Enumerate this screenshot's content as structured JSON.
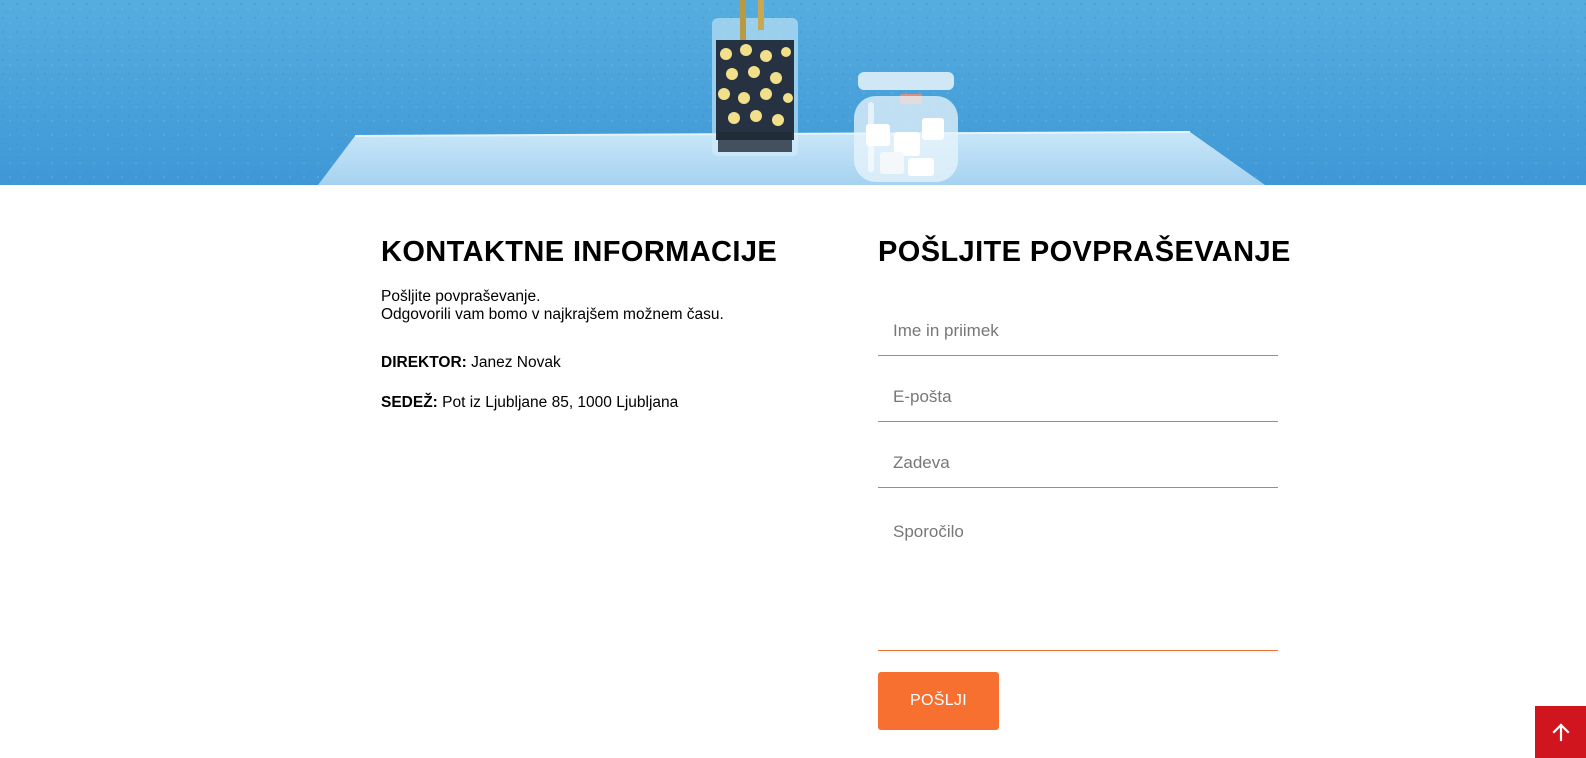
{
  "hero": {
    "image": "blue-wall-glass-jars-photo",
    "colors": {
      "wall": "#4fa6de",
      "table": "#b2daf4"
    }
  },
  "contact": {
    "heading": "KONTAKTNE INFORMACIJE",
    "intro_line1": "Pošljite povpraševanje.",
    "intro_line2": "Odgovorili vam bomo v najkrajšem možnem času.",
    "director_label": "DIREKTOR:",
    "director_value": " Janez Novak",
    "seat_label": "SEDEŽ:",
    "seat_value": " Pot iz Ljubljane 85, 1000 Ljubljana"
  },
  "form": {
    "heading": "POŠLJITE POVPRAŠEVANJE",
    "name_placeholder": "Ime in priimek",
    "email_placeholder": "E-pošta",
    "subject_placeholder": "Zadeva",
    "message_placeholder": "Sporočilo",
    "submit_label": "POŠLJI",
    "accent_color": "#f26f2f"
  },
  "back_to_top": {
    "icon": "arrow-up-icon",
    "color": "#d0151f"
  }
}
